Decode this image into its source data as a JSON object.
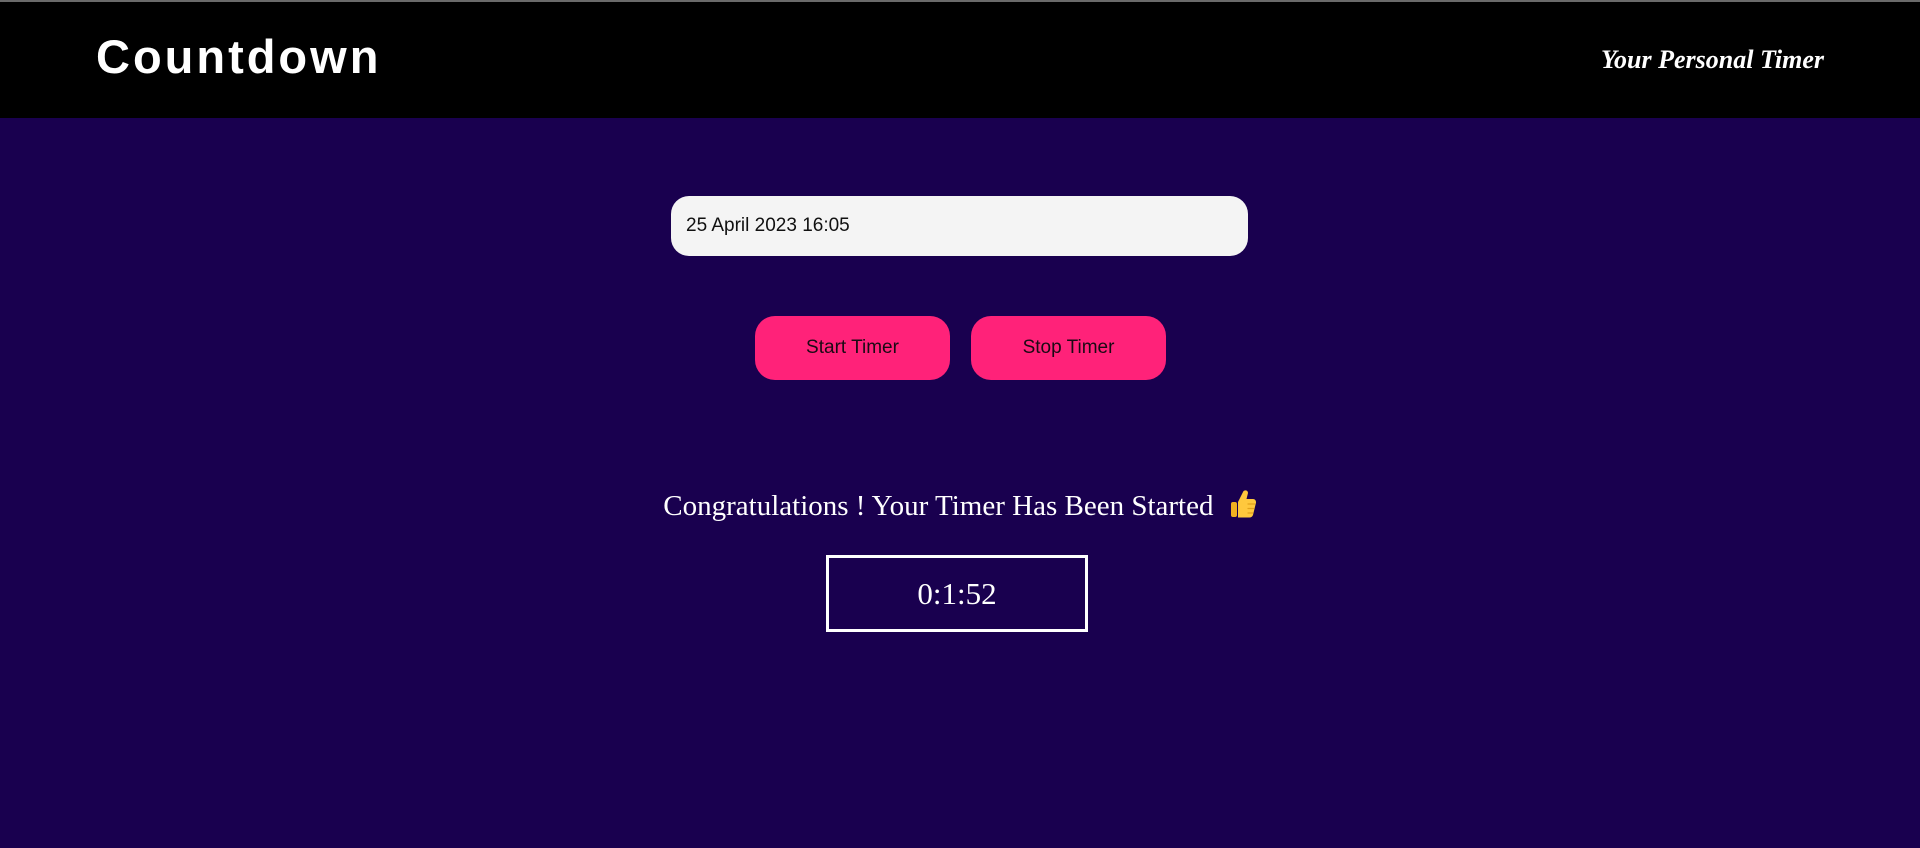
{
  "header": {
    "brand": "Countdown",
    "tagline": "Your Personal Timer"
  },
  "form": {
    "date_value": "25 April 2023 16:05",
    "start_label": "Start Timer",
    "stop_label": "Stop Timer"
  },
  "status": {
    "message": "Congratulations ! Your Timer Has Been Started",
    "icon": "thumbs-up-icon"
  },
  "timer": {
    "display": "0:1:52"
  },
  "colors": {
    "background": "#19004f",
    "header": "#000000",
    "accent": "#ff2279",
    "input_background": "#f4f4f4"
  }
}
